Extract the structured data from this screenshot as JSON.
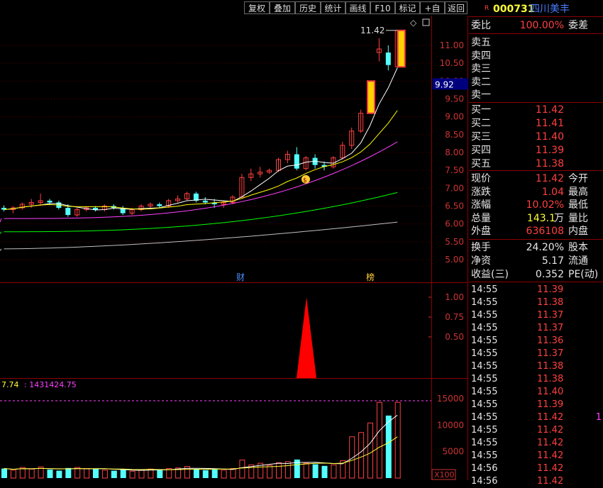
{
  "toolbar": {
    "buttons": [
      "复权",
      "叠加",
      "历史",
      "统计",
      "画线",
      "F10",
      "标记",
      "+自选",
      "返回"
    ]
  },
  "stock": {
    "badge": "R",
    "code": "000731",
    "name": "四川美丰"
  },
  "chart": {
    "price_axis_labels": [
      "11.00",
      "10.50",
      "10.00",
      "9.50",
      "9.00",
      "8.50",
      "8.00",
      "7.50",
      "7.00",
      "6.50",
      "6.00",
      "5.50",
      "5.00"
    ],
    "current_price_tag": "9.92",
    "high_label": "11.42",
    "markers": {
      "cai": "财",
      "bang": "榜"
    },
    "indicator_axis_labels": [
      "1.00",
      "0.75",
      "0.50"
    ],
    "volume_header_prefix": "7.74",
    "volume_header_value": "1431424.75",
    "volume_axis_labels": [
      "15000",
      "10000",
      "5000"
    ],
    "volume_unit": "X100"
  },
  "chart_data": {
    "type": "candlestick",
    "x": [
      1,
      2,
      3,
      4,
      5,
      6,
      7,
      8,
      9,
      10,
      11,
      12,
      13,
      14,
      15,
      16,
      17,
      18,
      19,
      20,
      21,
      22,
      23,
      24,
      25,
      26,
      27,
      28,
      29,
      30,
      31,
      32,
      33,
      34,
      35,
      36,
      37,
      38,
      39,
      40,
      41,
      42,
      43,
      44
    ],
    "ohlc": [
      [
        6.45,
        6.52,
        6.35,
        6.4
      ],
      [
        6.4,
        6.5,
        6.3,
        6.45
      ],
      [
        6.45,
        6.6,
        6.4,
        6.55
      ],
      [
        6.55,
        6.7,
        6.45,
        6.6
      ],
      [
        6.6,
        6.85,
        6.5,
        6.65
      ],
      [
        6.65,
        6.7,
        6.55,
        6.6
      ],
      [
        6.6,
        6.65,
        6.4,
        6.45
      ],
      [
        6.45,
        6.55,
        6.2,
        6.25
      ],
      [
        6.25,
        6.45,
        6.2,
        6.4
      ],
      [
        6.4,
        6.5,
        6.35,
        6.45
      ],
      [
        6.45,
        6.5,
        6.35,
        6.4
      ],
      [
        6.4,
        6.55,
        6.35,
        6.5
      ],
      [
        6.5,
        6.55,
        6.4,
        6.45
      ],
      [
        6.45,
        6.5,
        6.25,
        6.3
      ],
      [
        6.3,
        6.45,
        6.25,
        6.4
      ],
      [
        6.4,
        6.55,
        6.35,
        6.5
      ],
      [
        6.5,
        6.6,
        6.45,
        6.55
      ],
      [
        6.55,
        6.6,
        6.45,
        6.5
      ],
      [
        6.5,
        6.7,
        6.45,
        6.65
      ],
      [
        6.65,
        6.8,
        6.6,
        6.7
      ],
      [
        6.7,
        6.9,
        6.65,
        6.85
      ],
      [
        6.85,
        6.9,
        6.6,
        6.65
      ],
      [
        6.65,
        6.75,
        6.55,
        6.6
      ],
      [
        6.6,
        6.7,
        6.45,
        6.55
      ],
      [
        6.55,
        6.65,
        6.45,
        6.6
      ],
      [
        6.6,
        6.8,
        6.55,
        6.75
      ],
      [
        6.75,
        7.4,
        6.7,
        7.3
      ],
      [
        7.3,
        7.55,
        7.2,
        7.4
      ],
      [
        7.4,
        7.6,
        7.3,
        7.45
      ],
      [
        7.45,
        7.55,
        7.4,
        7.5
      ],
      [
        7.5,
        7.85,
        7.45,
        7.8
      ],
      [
        7.8,
        8.05,
        7.7,
        7.95
      ],
      [
        7.95,
        8.15,
        7.5,
        7.55
      ],
      [
        7.55,
        7.9,
        7.5,
        7.85
      ],
      [
        7.85,
        7.95,
        7.55,
        7.65
      ],
      [
        7.65,
        7.75,
        7.5,
        7.6
      ],
      [
        7.6,
        7.9,
        7.55,
        7.85
      ],
      [
        7.85,
        8.3,
        7.8,
        8.2
      ],
      [
        8.2,
        8.7,
        8.1,
        8.6
      ],
      [
        8.6,
        9.2,
        8.55,
        9.1
      ],
      [
        9.1,
        10.0,
        9.1,
        10.0
      ],
      [
        10.8,
        11.2,
        10.55,
        10.9
      ],
      [
        10.8,
        11.0,
        10.3,
        10.45
      ],
      [
        10.4,
        11.42,
        10.4,
        11.42
      ]
    ],
    "ylim": [
      4.8,
      11.6
    ],
    "indicator": {
      "ylim": [
        0,
        1.1
      ],
      "peak_x": 34,
      "peak_value": 1.0
    },
    "volume": {
      "values": [
        1800,
        1500,
        2000,
        1700,
        2100,
        1600,
        1400,
        1900,
        2000,
        1800,
        1700,
        1500,
        1400,
        1600,
        1300,
        1500,
        1700,
        1600,
        1800,
        1900,
        2200,
        1700,
        1500,
        1600,
        1500,
        1800,
        3400,
        2500,
        2800,
        2400,
        2900,
        3100,
        3500,
        2800,
        2600,
        2300,
        2500,
        3300,
        7800,
        8600,
        10400,
        14300,
        11800,
        14300
      ],
      "ylim": [
        0,
        16000
      ]
    }
  },
  "panel": {
    "weibi": {
      "label": "委比",
      "value": "100.00%",
      "label2": "委差"
    },
    "sells": [
      {
        "label": "卖五",
        "price": ""
      },
      {
        "label": "卖四",
        "price": ""
      },
      {
        "label": "卖三",
        "price": ""
      },
      {
        "label": "卖二",
        "price": ""
      },
      {
        "label": "卖一",
        "price": ""
      }
    ],
    "buys": [
      {
        "label": "买一",
        "price": "11.42"
      },
      {
        "label": "买二",
        "price": "11.41"
      },
      {
        "label": "买三",
        "price": "11.40"
      },
      {
        "label": "买四",
        "price": "11.39"
      },
      {
        "label": "买五",
        "price": "11.38"
      }
    ],
    "quote": [
      {
        "label": "现价",
        "value": "11.42",
        "value_color": "red",
        "label2": "今开"
      },
      {
        "label": "涨跌",
        "value": "1.04",
        "value_color": "red",
        "label2": "最高"
      },
      {
        "label": "涨幅",
        "value": "10.02%",
        "value_color": "red",
        "label2": "最低"
      },
      {
        "label": "总量",
        "value": "143.1",
        "value_suffix": "万",
        "value_color": "yellow",
        "label2": "量比"
      },
      {
        "label": "外盘",
        "value": "636108",
        "value_color": "red",
        "label2": "内盘"
      }
    ],
    "fin": [
      {
        "label": "换手",
        "value": "24.20%",
        "label2": "股本"
      },
      {
        "label": "净资",
        "value": "5.17",
        "label2": "流通"
      },
      {
        "label": "收益(三)",
        "value": "0.352",
        "label2": "PE(动)"
      }
    ],
    "ticks": [
      {
        "time": "14:55",
        "price": "11.39"
      },
      {
        "time": "14:55",
        "price": "11.38"
      },
      {
        "time": "14:55",
        "price": "11.37"
      },
      {
        "time": "14:55",
        "price": "11.37"
      },
      {
        "time": "14:55",
        "price": "11.36"
      },
      {
        "time": "14:55",
        "price": "11.37"
      },
      {
        "time": "14:55",
        "price": "11.38"
      },
      {
        "time": "14:55",
        "price": "11.38"
      },
      {
        "time": "14:55",
        "price": "11.40"
      },
      {
        "time": "14:55",
        "price": "11.39"
      },
      {
        "time": "14:55",
        "price": "11.42"
      },
      {
        "time": "14:55",
        "price": "11.42"
      },
      {
        "time": "14:55",
        "price": "11.42"
      },
      {
        "time": "14:55",
        "price": "11.42"
      },
      {
        "time": "14:56",
        "price": "11.42"
      },
      {
        "time": "14:56",
        "price": "11.42"
      }
    ],
    "tick_extra": "1",
    "colors": {
      "up": "#ff4040",
      "down": "#54ffff",
      "ma5": "#ffffff",
      "ma10": "#ffff00",
      "ma20": "#ff40ff",
      "ma60": "#00ff00",
      "ma120": "#c0c0c0",
      "tag_bg": "#00007f"
    }
  }
}
